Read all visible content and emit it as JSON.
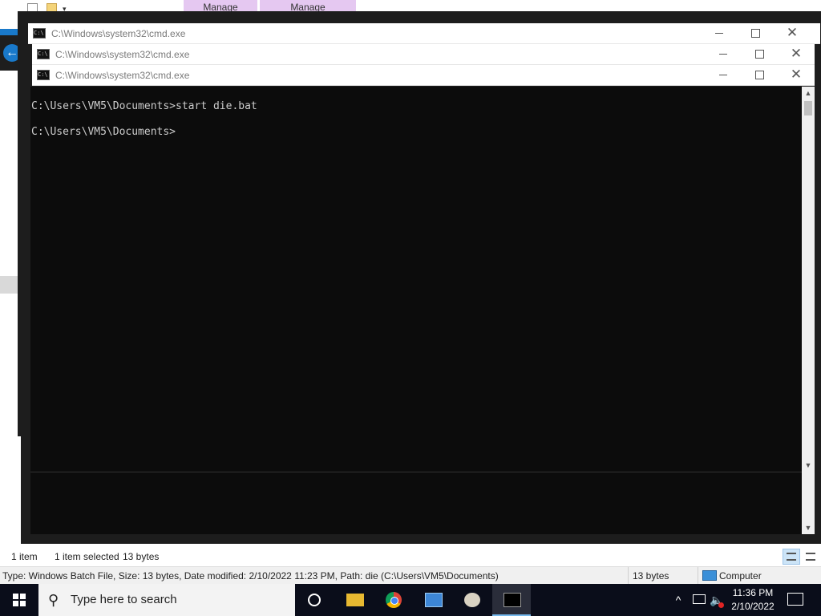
{
  "explorer": {
    "ribbon_tabs": [
      "Manage",
      "Manage"
    ],
    "status": {
      "item_count": "1 item",
      "selected": "1 item selected",
      "size": "13 bytes"
    },
    "details_bar": {
      "info": "Type: Windows Batch File, Size: 13 bytes, Date modified: 2/10/2022 11:23 PM, Path: die (C:\\Users\\VM5\\Documents)",
      "size": "13 bytes",
      "location": "Computer"
    }
  },
  "windows": [
    {
      "title": "C:\\Windows\\system32\\cmd.exe"
    },
    {
      "title": "C:\\Windows\\system32\\cmd.exe"
    },
    {
      "title": "C:\\Windows\\system32\\cmd.exe"
    }
  ],
  "console": {
    "lines": [
      "C:\\Users\\VM5\\Documents>start die.bat",
      "C:\\Users\\VM5\\Documents>"
    ]
  },
  "taskbar": {
    "search_placeholder": "Type here to search",
    "time": "11:36 PM",
    "date": "2/10/2022",
    "icons": [
      "windows-logo",
      "cortana-circle",
      "file-explorer",
      "chrome",
      "system-information",
      "paint",
      "command-prompt"
    ]
  },
  "controls": {
    "minimize": "—",
    "maximize": "☐",
    "close": "✕"
  }
}
